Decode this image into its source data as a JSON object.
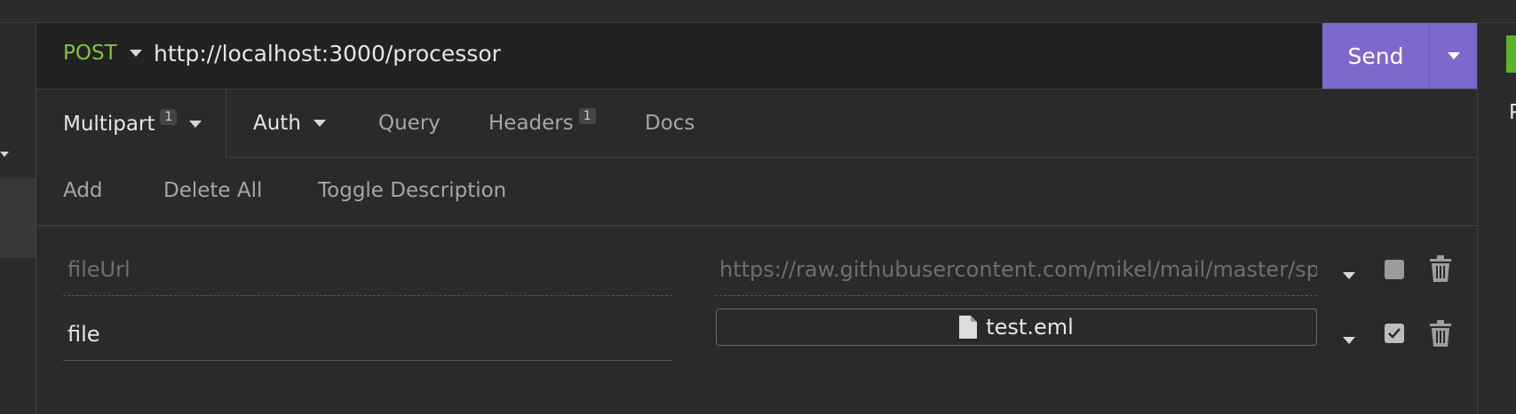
{
  "request": {
    "method": "POST",
    "url": "http://localhost:3000/processor",
    "send_label": "Send"
  },
  "tabs": [
    {
      "label": "Multipart",
      "badge": "1"
    },
    {
      "label": "Auth"
    },
    {
      "label": "Query"
    },
    {
      "label": "Headers",
      "badge": "1"
    },
    {
      "label": "Docs"
    }
  ],
  "actions": {
    "add": "Add",
    "delete_all": "Delete All",
    "toggle_description": "Toggle Description"
  },
  "params": [
    {
      "name": "fileUrl",
      "value": "https://raw.githubusercontent.com/mikel/mail/master/sp",
      "enabled": false
    },
    {
      "name": "file",
      "value": "test.eml",
      "enabled": true
    }
  ],
  "right_panel": {
    "letter": "P"
  },
  "colors": {
    "method": "#82c341",
    "send": "#7d69cb",
    "status_green": "#5bb32e"
  }
}
